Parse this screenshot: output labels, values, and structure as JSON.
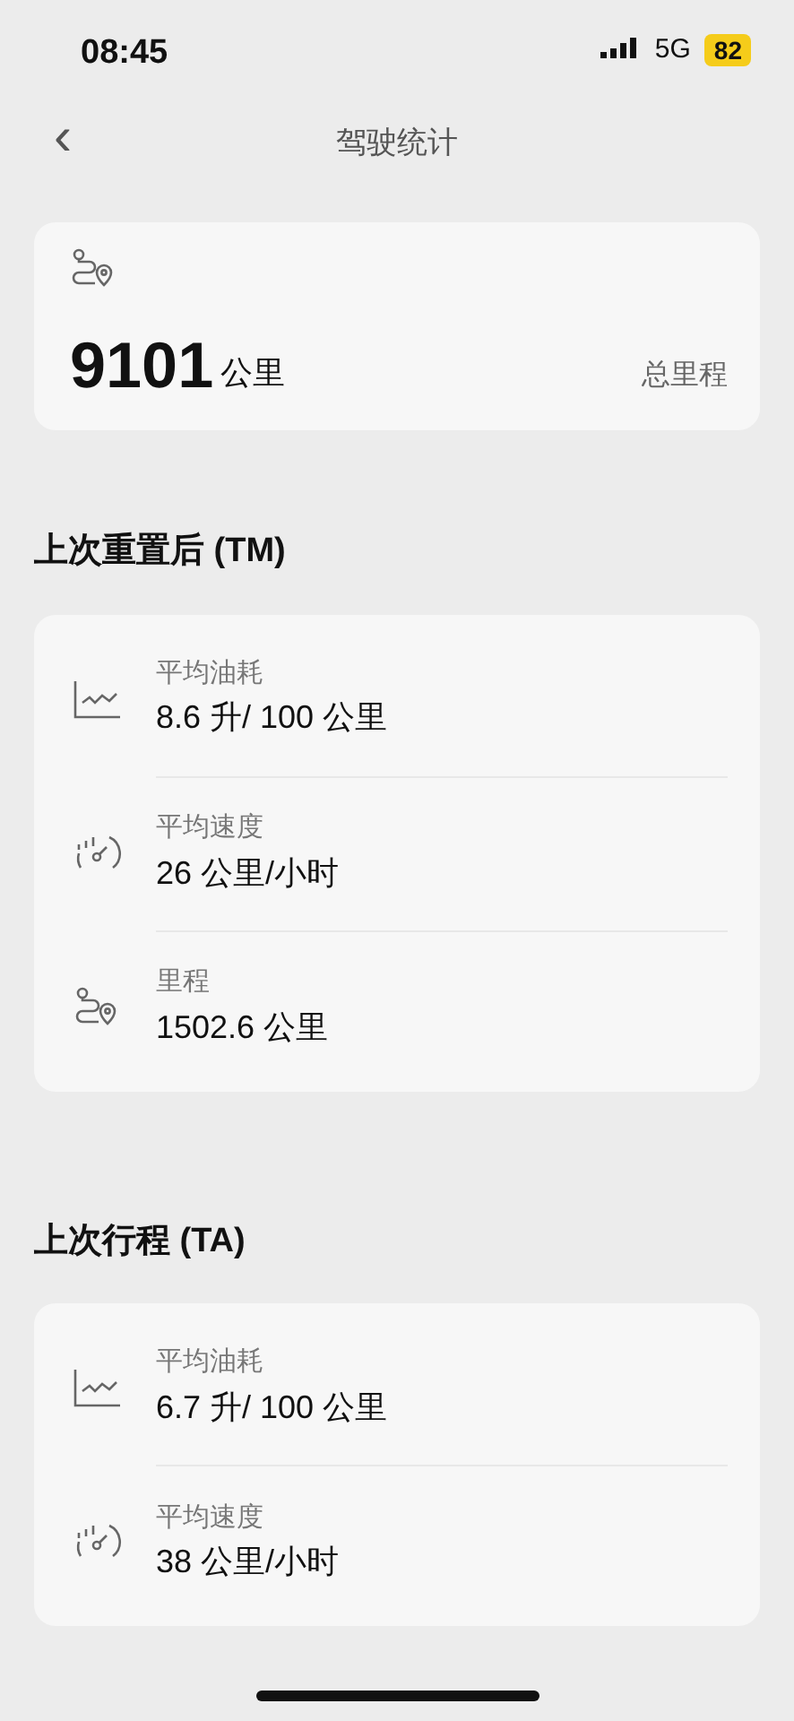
{
  "status_bar": {
    "time": "08:45",
    "network": "5G",
    "battery": "82"
  },
  "nav": {
    "back": "‹",
    "title": "驾驶统计"
  },
  "total": {
    "kind": "route",
    "value": "9101",
    "unit": "公里",
    "label": "总里程"
  },
  "sections": [
    {
      "title": "上次重置后 (TM)",
      "items": [
        {
          "kind": "fuel",
          "label": "平均油耗",
          "value": "8.6 升/ 100 公里"
        },
        {
          "kind": "speed",
          "label": "平均速度",
          "value": "26 公里/小时"
        },
        {
          "kind": "route",
          "label": "里程",
          "value": "1502.6 公里"
        }
      ]
    },
    {
      "title": "上次行程 (TA)",
      "items": [
        {
          "kind": "fuel",
          "label": "平均油耗",
          "value": "6.7 升/ 100 公里"
        },
        {
          "kind": "speed",
          "label": "平均速度",
          "value": "38 公里/小时"
        }
      ]
    }
  ]
}
